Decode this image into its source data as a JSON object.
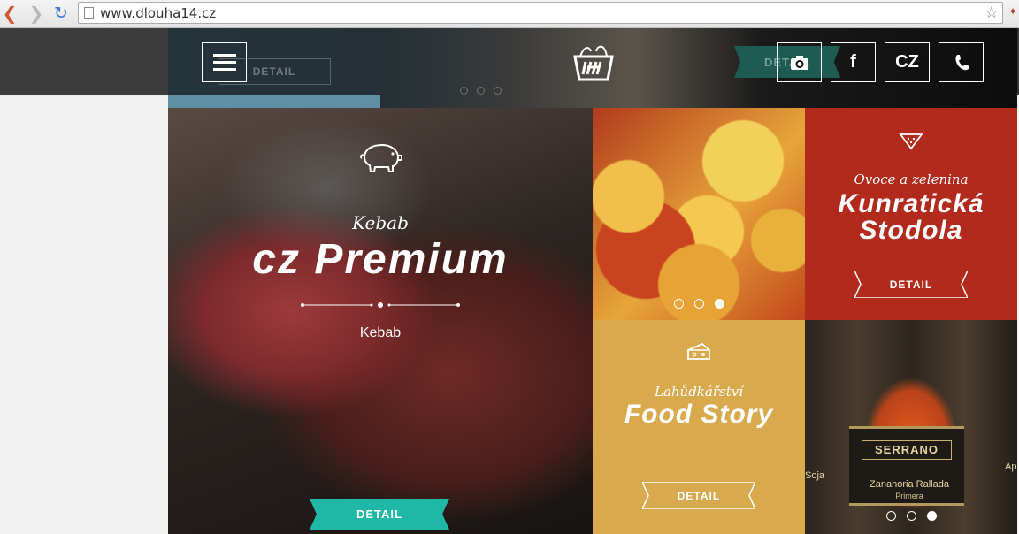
{
  "browser": {
    "url": "www.dlouha14.cz"
  },
  "header": {
    "ghost_left_label": "DETAIL",
    "ghost_right_label": "DETAIL",
    "language_label": "CZ"
  },
  "tiles": {
    "steak": {
      "script": "Kebab",
      "title": "cz Premium",
      "subtitle": "Kebab",
      "button": "DETAIL"
    },
    "fruit": {
      "script": "Ovoce a zelenina",
      "title_line1": "Kunratická",
      "title_line2": "Stodola",
      "button": "DETAIL"
    },
    "deli": {
      "script": "Lahůdkářství",
      "title": "Food Story",
      "button": "DETAIL"
    },
    "jars": {
      "brand": "SERRANO",
      "label_line": "Zanahoria Rallada",
      "label_sub": "Primera",
      "side_text": "Soja",
      "side_text_right": "Apio"
    }
  },
  "colors": {
    "teal": "#1fb8a6",
    "red": "#b12a1c",
    "mustard": "#d9a94d"
  }
}
